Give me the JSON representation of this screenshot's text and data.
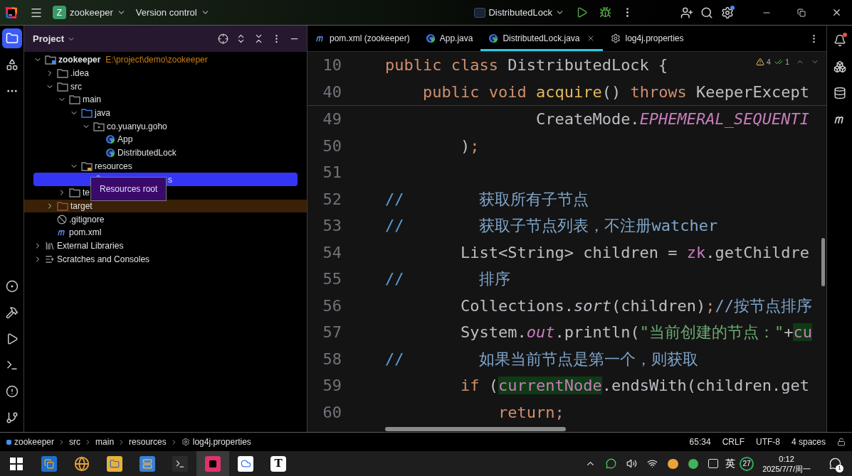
{
  "title_bar": {
    "project_badge": "Z",
    "project": "zookeeper",
    "vcs": "Version control",
    "run_config": "DistributedLock",
    "settings_badge": true
  },
  "left_toolbar": [
    {
      "kind": "project",
      "selected": true
    },
    {
      "kind": "structure",
      "selected": false
    },
    {
      "kind": "more",
      "selected": false
    },
    {
      "kind": "services",
      "selected": false
    },
    {
      "kind": "build",
      "selected": false
    },
    {
      "kind": "run",
      "selected": false
    },
    {
      "kind": "terminal",
      "selected": false
    },
    {
      "kind": "problems",
      "selected": false
    },
    {
      "kind": "git",
      "selected": false
    }
  ],
  "project_panel": {
    "title": "Project",
    "tooltip": "Resources root",
    "tree": [
      {
        "label": "zookeeper",
        "path": "E:\\project\\demo\\zookeeper",
        "kind": "module",
        "expanded": true,
        "selected": false,
        "children": [
          {
            "label": ".idea",
            "kind": "folder",
            "expanded": false,
            "selected": false
          },
          {
            "label": "src",
            "kind": "folder",
            "expanded": true,
            "selected": false,
            "children": [
              {
                "label": "main",
                "kind": "folder",
                "expanded": true,
                "selected": false,
                "children": [
                  {
                    "label": "java",
                    "kind": "source",
                    "expanded": true,
                    "selected": false,
                    "children": [
                      {
                        "label": "co.yuanyu.goho",
                        "kind": "package",
                        "expanded": true,
                        "selected": false,
                        "children": [
                          {
                            "label": "App",
                            "kind": "class",
                            "selected": false
                          },
                          {
                            "label": "DistributedLock",
                            "kind": "class",
                            "selected": false
                          }
                        ]
                      }
                    ]
                  },
                  {
                    "label": "resources",
                    "kind": "resources",
                    "expanded": true,
                    "selected": false,
                    "children": [
                      {
                        "label": "s",
                        "kind": "properties",
                        "selected": true,
                        "partially_covered": true
                      }
                    ]
                  }
                ]
              },
              {
                "label": "te",
                "kind": "folder",
                "expanded": false,
                "selected": false
              }
            ]
          },
          {
            "label": "target",
            "kind": "excluded",
            "expanded": false,
            "selected": false
          },
          {
            "label": ".gitignore",
            "kind": "ignore",
            "selected": false
          },
          {
            "label": "pom.xml",
            "kind": "maven",
            "selected": false
          }
        ]
      },
      {
        "label": "External Libraries",
        "kind": "libraries",
        "expanded": false,
        "selected": false
      },
      {
        "label": "Scratches and Consoles",
        "kind": "scratches",
        "expanded": false,
        "selected": false
      }
    ]
  },
  "editor_tabs": [
    {
      "label": "pom.xml (zookeeper)",
      "kind": "maven",
      "selected": false,
      "closable": false
    },
    {
      "label": "App.java",
      "kind": "class",
      "selected": false,
      "closable": false
    },
    {
      "label": "DistributedLock.java",
      "kind": "class",
      "selected": true,
      "closable": true
    },
    {
      "label": "log4j.properties",
      "kind": "properties",
      "selected": false,
      "closable": false
    }
  ],
  "inspections": {
    "warnings": "4",
    "checks": "1"
  },
  "sticky_lines": [
    {
      "number": "10",
      "tokens": [
        {
          "kind": "kw",
          "text": "public class "
        },
        {
          "kind": "plain",
          "text": "DistributedLock {"
        }
      ]
    },
    {
      "number": "40",
      "tokens": [
        {
          "kind": "kw",
          "text": "    public void "
        },
        {
          "kind": "method",
          "text": "acquire"
        },
        {
          "kind": "plain",
          "text": "() "
        },
        {
          "kind": "kw",
          "text": "throws "
        },
        {
          "kind": "plain",
          "text": "KeeperExcept"
        }
      ]
    }
  ],
  "lines": [
    {
      "number": "49",
      "tokens": [
        {
          "kind": "plain",
          "text": "                CreateMode."
        },
        {
          "kind": "field",
          "text": "EPHEMERAL_SEQUENTI"
        }
      ]
    },
    {
      "number": "50",
      "tokens": [
        {
          "kind": "plain",
          "text": "        )"
        },
        {
          "kind": "punct",
          "text": ";"
        }
      ]
    },
    {
      "number": "51"
    },
    {
      "number": "52",
      "tokens": [
        {
          "kind": "comment_mark",
          "text": "//"
        },
        {
          "kind": "comment",
          "text": "        获取所有子节点"
        }
      ]
    },
    {
      "number": "53",
      "tokens": [
        {
          "kind": "comment_mark",
          "text": "//"
        },
        {
          "kind": "comment",
          "text": "        获取子节点列表，不注册watcher"
        }
      ]
    },
    {
      "number": "54",
      "tokens": [
        {
          "kind": "plain",
          "text": "        List<String> children = "
        },
        {
          "kind": "var",
          "text": "zk"
        },
        {
          "kind": "plain",
          "text": ".getChildre"
        }
      ]
    },
    {
      "number": "55",
      "tokens": [
        {
          "kind": "comment_mark",
          "text": "//"
        },
        {
          "kind": "comment",
          "text": "        排序"
        }
      ]
    },
    {
      "number": "56",
      "tokens": [
        {
          "kind": "plain",
          "text": "        Collections."
        },
        {
          "kind": "italic",
          "text": "sort"
        },
        {
          "kind": "plain",
          "text": "(children)"
        },
        {
          "kind": "punct",
          "text": ";"
        },
        {
          "kind": "comment",
          "text": "//按节点排序"
        }
      ]
    },
    {
      "number": "57",
      "tokens": [
        {
          "kind": "plain",
          "text": "        System."
        },
        {
          "kind": "field",
          "text": "out"
        },
        {
          "kind": "plain",
          "text": ".println("
        },
        {
          "kind": "str",
          "text": "\"当前创建的节点：\""
        },
        {
          "kind": "plain",
          "text": "+"
        },
        {
          "kind": "hl",
          "text": "cu"
        }
      ]
    },
    {
      "number": "58",
      "tokens": [
        {
          "kind": "comment_mark",
          "text": "//"
        },
        {
          "kind": "comment",
          "text": "        如果当前节点是第一个，则获取"
        }
      ]
    },
    {
      "number": "59",
      "tokens": [
        {
          "kind": "kw",
          "text": "        if "
        },
        {
          "kind": "plain",
          "text": "("
        },
        {
          "kind": "hl",
          "text": "currentNode"
        },
        {
          "kind": "plain",
          "text": ".endsWith(children.get"
        }
      ]
    },
    {
      "number": "60",
      "tokens": [
        {
          "kind": "kw",
          "text": "            return"
        },
        {
          "kind": "punct",
          "text": ";"
        }
      ]
    }
  ],
  "right_toolbar": [
    {
      "kind": "notifications",
      "badge": true
    },
    {
      "kind": "ai",
      "badge": false
    },
    {
      "kind": "database",
      "badge": false
    },
    {
      "kind": "maven",
      "badge": false
    }
  ],
  "status_bar": {
    "breadcrumbs": [
      {
        "label": "zookeeper",
        "kind": "module"
      },
      {
        "label": "src",
        "kind": "folder"
      },
      {
        "label": "main",
        "kind": "folder"
      },
      {
        "label": "resources",
        "kind": "folder"
      },
      {
        "label": "log4j.properties",
        "kind": "properties"
      }
    ],
    "position": "65:34",
    "line_separator": "CRLF",
    "encoding": "UTF-8",
    "indent": "4 spaces"
  },
  "taskbar": {
    "apps": [
      {
        "kind": "start",
        "selected": false
      },
      {
        "kind": "vm",
        "selected": false
      },
      {
        "kind": "browser",
        "selected": false
      },
      {
        "kind": "files",
        "selected": false
      },
      {
        "kind": "store",
        "selected": false
      },
      {
        "kind": "console",
        "selected": false
      },
      {
        "kind": "ide",
        "selected": true
      },
      {
        "kind": "cloud",
        "selected": false
      },
      {
        "kind": "typora",
        "label": "T",
        "selected": false
      }
    ],
    "tray": {
      "input_method": "英",
      "badge": "27",
      "time": "0:12",
      "date": "2025/7/7/周一",
      "notifications": "1"
    }
  }
}
